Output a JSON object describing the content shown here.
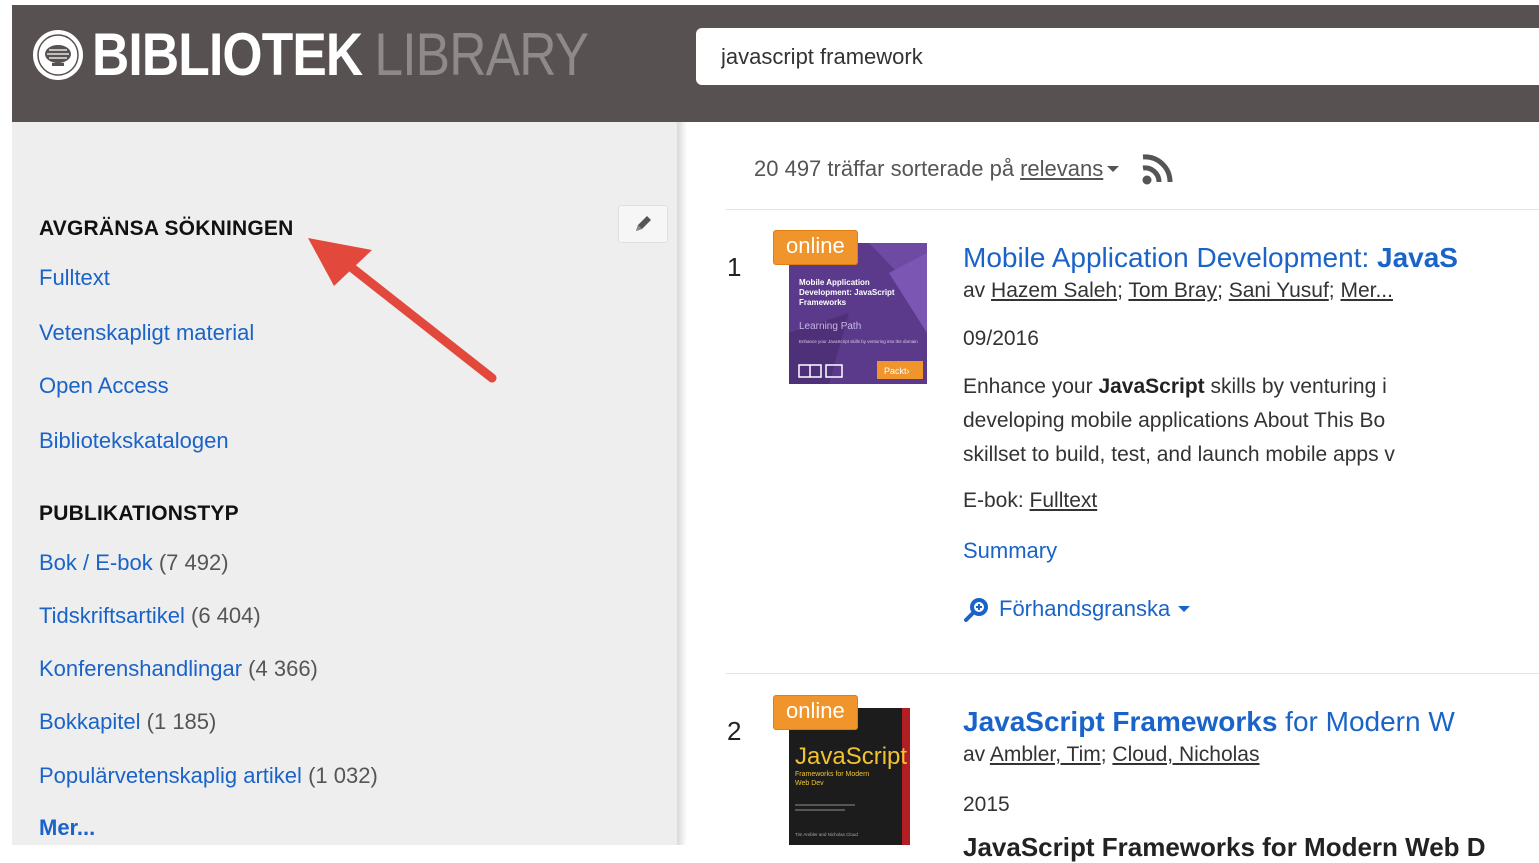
{
  "header": {
    "brand_strong": "BIBLIOTEK",
    "brand_light": "LIBRARY",
    "search_value": "javascript framework"
  },
  "sidebar": {
    "refine_heading": "AVGRÄNSA SÖKNINGEN",
    "refine_links": [
      "Fulltext",
      "Vetenskapligt material",
      "Open Access",
      "Bibliotekskatalogen"
    ],
    "pubtype_heading": "PUBLIKATIONSTYP",
    "pubtypes": [
      {
        "label": "Bok / E-bok",
        "count": "(7 492)"
      },
      {
        "label": "Tidskriftsartikel",
        "count": "(6 404)"
      },
      {
        "label": "Konferenshandlingar",
        "count": "(4 366)"
      },
      {
        "label": "Bokkapitel",
        "count": "(1 185)"
      },
      {
        "label": "Populärvetenskaplig artikel",
        "count": "(1 032)"
      }
    ],
    "more": "Mer..."
  },
  "results": {
    "count_text": "20 497 träffar sorterade på",
    "sort_label": "relevans",
    "items": [
      {
        "number": "1",
        "badge": "online",
        "title_plain": "Mobile Application Development:",
        "title_bold": "JavaS",
        "by": "av",
        "authors": [
          "Hazem Saleh",
          "Tom Bray",
          "Sani Yusuf",
          "Mer..."
        ],
        "date": "09/2016",
        "desc_pre": "Enhance your",
        "desc_bold": "JavaScript",
        "desc_post": "skills by venturing i",
        "desc_line2": "developing mobile applications About This Bo",
        "desc_line3": "skillset to build, test, and launch mobile apps v",
        "format_label": "E-bok:",
        "format_link": "Fulltext",
        "summary": "Summary",
        "preview": "Förhandsgranska",
        "cover": {
          "title": "Mobile Application Development: JavaScript Frameworks",
          "subtitle": "Learning Path",
          "blurb": "Enhance your JavaScript skills by venturing into the domain of developing mobile applications",
          "publisher": "Packt›"
        }
      },
      {
        "number": "2",
        "badge": "online",
        "title_bold": "JavaScript Frameworks",
        "title_plain": "for Modern W",
        "by": "av",
        "authors": [
          "Ambler, Tim",
          "Cloud, Nicholas"
        ],
        "date": "2015",
        "cover": {
          "title": "JavaScript",
          "subtitle": "Frameworks for Modern Web Dev",
          "authors": "Tim Ambler and Nicholas Cloud"
        }
      }
    ],
    "cutoff_text": "JavaScript Frameworks for Modern Web D"
  },
  "colors": {
    "header_bg": "#575151",
    "sidebar_bg": "#eeeeee",
    "link": "#1a63c8",
    "badge": "#f0952c",
    "arrow": "#e2493c",
    "cover1": "#5b3a8c",
    "cover2": "#1c1c1c"
  },
  "icons": [
    "university-seal-icon",
    "pencil-icon",
    "annotation-arrow-icon",
    "rss-icon",
    "preview-magnifier-icon",
    "caret-down-icon"
  ]
}
